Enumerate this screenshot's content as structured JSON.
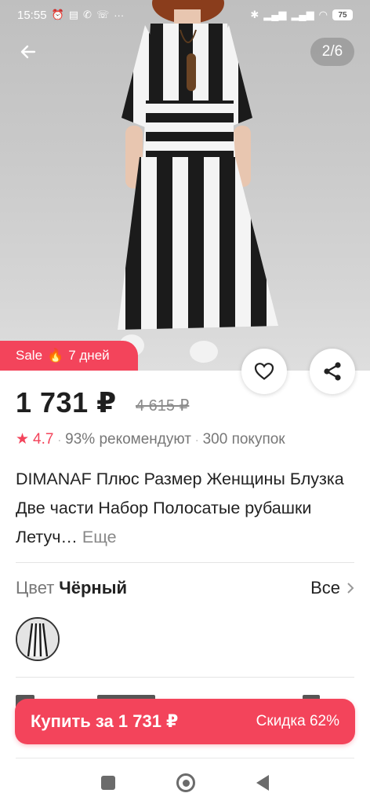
{
  "status_bar": {
    "time": "15:55",
    "left_icons": [
      "alarm-icon",
      "message-icon",
      "whatsapp-icon",
      "missed-call-icon",
      "more-dots-icon"
    ],
    "right_icons": [
      "bluetooth-icon",
      "signal-icon",
      "signal-icon",
      "wifi-icon"
    ],
    "battery": "75"
  },
  "gallery": {
    "counter": "2/6"
  },
  "sale_badge": {
    "label": "Sale",
    "emoji": "🔥",
    "days": "7 дней"
  },
  "product": {
    "price": "1 731 ₽",
    "old_price": "4 615 ₽",
    "rating": "4.7",
    "recommend": "93% рекомендуют",
    "purchases": "300 покупок",
    "title": "DIMANAF Плюс Размер Женщины Блузка Две части Набор Полосатые рубашки Летуч…",
    "more_label": "Еще"
  },
  "color": {
    "label": "Цвет",
    "value": "Чёрный",
    "all_label": "Все"
  },
  "buy_button": {
    "label": "Купить за 1 731 ₽",
    "discount": "Скидка 62%"
  },
  "colors": {
    "accent": "#f3445b",
    "text": "#222222",
    "muted": "#777777"
  }
}
